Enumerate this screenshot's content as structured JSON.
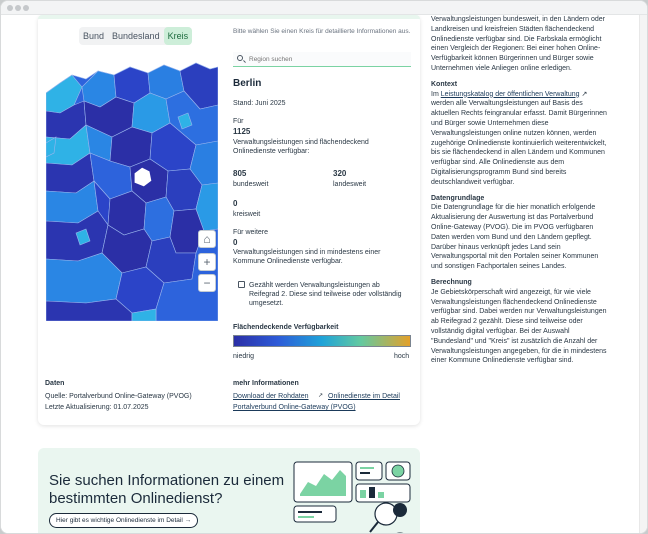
{
  "tabs": [
    "Bund",
    "Bundesland",
    "Kreis"
  ],
  "active_tab": "Kreis",
  "hint": "Bitte wählen Sie einen Kreis für detaillierte Informationen aus.",
  "search": {
    "placeholder": "Region suchen"
  },
  "region": {
    "name": "Berlin",
    "stand": "Stand: Juni 2025",
    "fuer_label": "Für",
    "total": "1125",
    "total_desc": "Verwaltungsleistungen sind flächendeckend Onlinedienste verfügbar:",
    "bundesweit_value": "805",
    "bundesweit_label": "bundesweit",
    "landesweit_value": "320",
    "landesweit_label": "landesweit",
    "kreisweit_value": "0",
    "kreisweit_label": "kreisweit",
    "weitere_label": "Für weitere",
    "weitere_value": "0",
    "weitere_desc": "Verwaltungsleistungen sind in mindestens einer Kommune Onlinedienste verfügbar.",
    "note": "Gezählt werden Verwaltungsleistungen ab Reifegrad 2. Diese sind teilweise oder vollständig umgesetzt."
  },
  "legend": {
    "title": "Flächendeckende Verfügbarkeit",
    "low": "niedrig",
    "high": "hoch"
  },
  "map_controls": {
    "home": "⌂",
    "zoom_in": "+",
    "zoom_out": "−"
  },
  "daten": {
    "title": "Daten",
    "source": "Quelle: Portalverbund Online-Gateway (PVOG)",
    "updated": "Letzte Aktualisierung: 01.07.2025"
  },
  "more": {
    "title": "mehr Informationen",
    "link1": "Download der Rohdaten",
    "link2": "Onlinedienste im Detail",
    "link3": "Portalverbund Online-Gateway (PVOG)"
  },
  "right": {
    "intro": "Verwaltungsleistungen bundesweit, in den Ländern oder Landkreisen und kreisfreien Städten flächendeckend Onlinedienste verfügbar sind. Die Farbskala ermöglicht einen Vergleich der Regionen: Bei einer hohen Online-Verfügbarkeit können Bürgerinnen und Bürger sowie Unternehmen viele Anliegen online erledigen.",
    "kontext_title": "Kontext",
    "kontext_pre": "Im",
    "kontext_link": "Leistungskatalog der öffentlichen Verwaltung",
    "kontext_post": "werden alle Verwaltungsleistungen auf Basis des aktuellen Rechts feingranular erfasst. Damit Bürgerinnen und Bürger sowie Unternehmen diese Verwaltungsleistungen online nutzen können, werden zugehörige Onlinedienste kontinuierlich weiterentwickelt, bis sie flächendeckend in allen Ländern und Kommunen verfügbar sind. Alle Onlinedienste aus dem Digitalisierungsprogramm Bund sind bereits deutschlandweit verfügbar.",
    "datengrundlage_title": "Datengrundlage",
    "datengrundlage_text": "Die Datengrundlage für die hier monatlich erfolgende Aktualisierung der Auswertung ist das Portalverbund Online-Gateway (PVOG). Die im PVOG verfügbaren Daten werden vom Bund und den Ländern gepflegt. Darüber hinaus verknüpft jedes Land sein Verwaltungsportal mit den Portalen seiner Kommunen und sonstigen Fachportalen seines Landes.",
    "berechnung_title": "Berechnung",
    "berechnung_text": "Je Gebietskörperschaft wird angezeigt, für wie viele Verwaltungsleistungen flächendeckend Onlinedienste verfügbar sind. Dabei werden nur Verwaltungsleistungen ab Reifegrad 2 gezählt. Diese sind teilweise oder vollständig digital verfügbar. Bei der Auswahl \"Bundesland\" und \"Kreis\" ist zusätzlich die Anzahl der Verwaltungsleistungen angegeben, für die in mindestens einer Kommune Onlinedienste verfügbar sind."
  },
  "promo": {
    "title": "Sie suchen Informationen zu einem bestimmten Onlinedienst?",
    "button": "Hier gibt es wichtige Onlinedienste im Detail →"
  },
  "colors": {
    "accent": "#7bd3a3",
    "map_dark": "#2b2fa6",
    "map_mid": "#2d6fe0",
    "map_light": "#2fb2e6"
  }
}
